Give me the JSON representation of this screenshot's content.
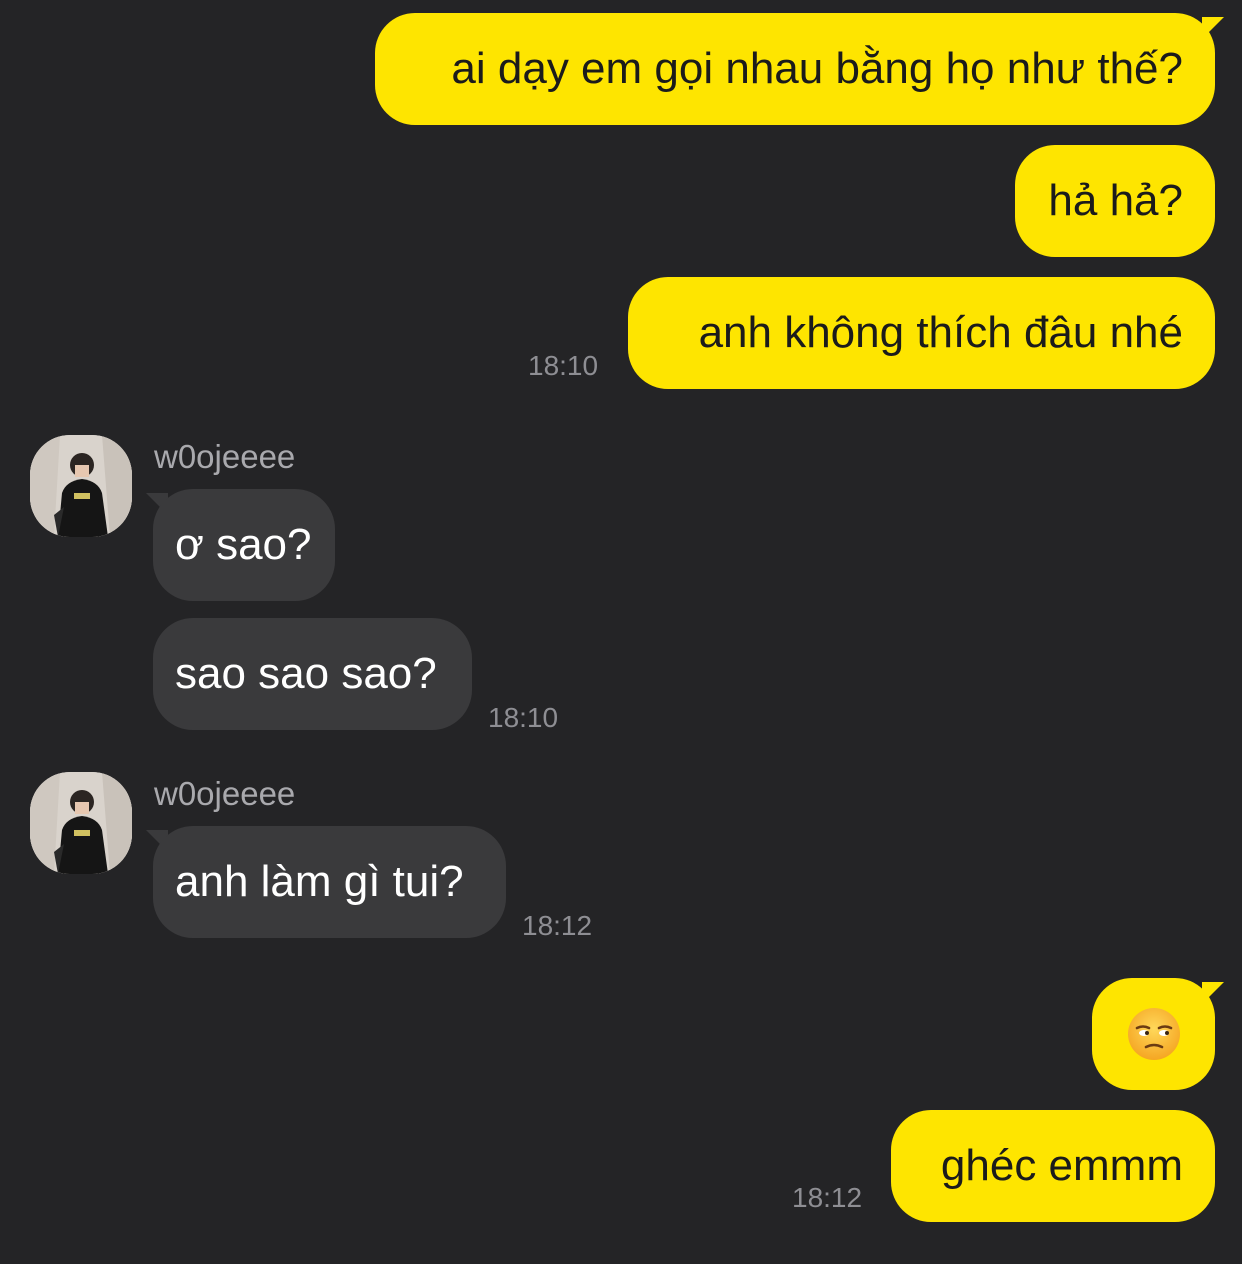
{
  "chat": {
    "messages": [
      {
        "text": "ai dạy em gọi nhau bằng họ như thế?"
      },
      {
        "text": "hả hả?"
      },
      {
        "text": "anh không thích đâu nhé"
      },
      {
        "text": "ơ sao?"
      },
      {
        "text": "sao sao sao?"
      },
      {
        "text": "anh làm gì tui?"
      },
      {
        "text": "ghéc emmm"
      }
    ],
    "timestamps": [
      "18:10",
      "18:10",
      "18:12",
      "18:12"
    ],
    "sender_names": [
      "w0ojeeee",
      "w0ojeeee"
    ],
    "emoji_message": {
      "icon": "unamused-face-icon"
    }
  },
  "colors": {
    "background": "#242426",
    "my_bubble": "#FEE500",
    "their_bubble": "#3a3a3c",
    "timestamp": "#8e8e93"
  }
}
